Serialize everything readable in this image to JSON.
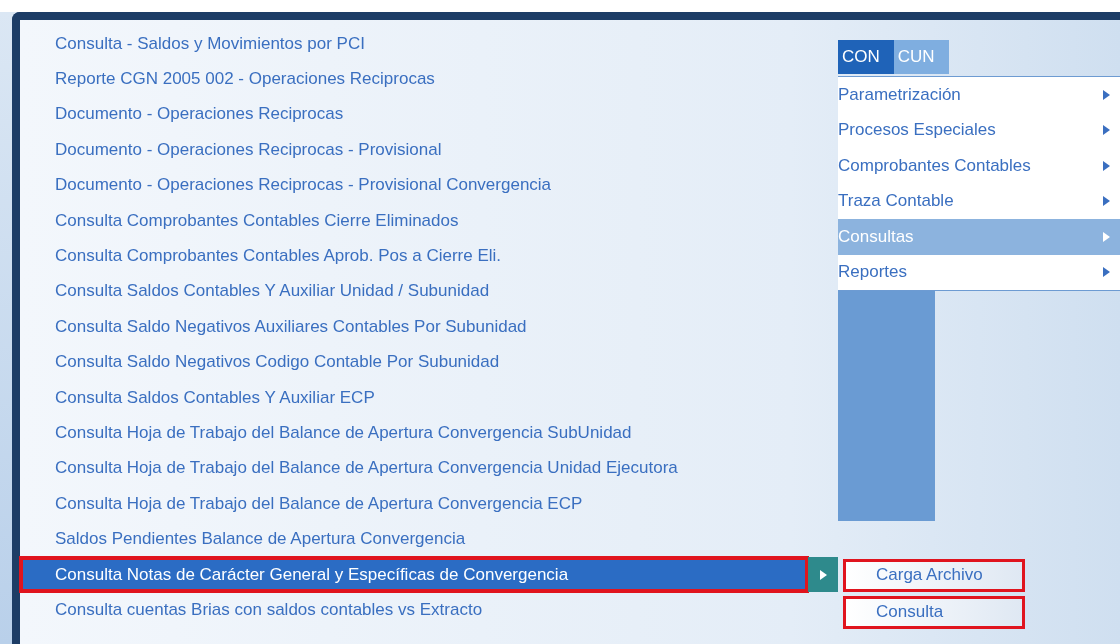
{
  "top_tabs": [
    {
      "label": "CON",
      "selected": true
    },
    {
      "label": "CUN",
      "selected": false
    }
  ],
  "module_menu": [
    {
      "label": "Parametrización",
      "selected": false
    },
    {
      "label": "Procesos Especiales",
      "selected": false
    },
    {
      "label": "Comprobantes Contables",
      "selected": false
    },
    {
      "label": "Traza Contable",
      "selected": false
    },
    {
      "label": "Consultas",
      "selected": true
    },
    {
      "label": "Reportes",
      "selected": false
    }
  ],
  "consultas_menu": [
    {
      "label": "Consulta - Saldos y Movimientos por PCI",
      "selected": false,
      "highlighted": false
    },
    {
      "label": "Reporte CGN 2005 002 - Operaciones Reciprocas",
      "selected": false,
      "highlighted": false
    },
    {
      "label": "Documento - Operaciones Reciprocas",
      "selected": false,
      "highlighted": false
    },
    {
      "label": "Documento - Operaciones Reciprocas - Provisional",
      "selected": false,
      "highlighted": false
    },
    {
      "label": "Documento - Operaciones Reciprocas - Provisional Convergencia",
      "selected": false,
      "highlighted": false
    },
    {
      "label": "Consulta Comprobantes Contables Cierre Eliminados",
      "selected": false,
      "highlighted": false
    },
    {
      "label": "Consulta Comprobantes Contables Aprob. Pos a Cierre Eli.",
      "selected": false,
      "highlighted": false
    },
    {
      "label": "Consulta Saldos Contables Y Auxiliar Unidad / Subunidad",
      "selected": false,
      "highlighted": false
    },
    {
      "label": "Consulta Saldo Negativos Auxiliares Contables Por Subunidad",
      "selected": false,
      "highlighted": false
    },
    {
      "label": "Consulta Saldo Negativos Codigo Contable Por Subunidad",
      "selected": false,
      "highlighted": false
    },
    {
      "label": "Consulta Saldos Contables Y Auxiliar ECP",
      "selected": false,
      "highlighted": false
    },
    {
      "label": "Consulta Hoja de Trabajo del Balance de Apertura Convergencia SubUnidad",
      "selected": false,
      "highlighted": false
    },
    {
      "label": "Consulta Hoja de Trabajo del Balance de Apertura Convergencia Unidad Ejecutora",
      "selected": false,
      "highlighted": false
    },
    {
      "label": "Consulta Hoja de Trabajo del Balance de Apertura Convergencia ECP",
      "selected": false,
      "highlighted": false
    },
    {
      "label": "Saldos Pendientes Balance de Apertura Convergencia",
      "selected": false,
      "highlighted": false
    },
    {
      "label": "Consulta Notas de Carácter General y Específicas de Convergencia",
      "selected": true,
      "highlighted": true
    },
    {
      "label": "Consulta cuentas Brias con saldos contables vs Extracto",
      "selected": false,
      "highlighted": false
    }
  ],
  "submenu": [
    {
      "label": "Carga Archivo",
      "highlighted": true
    },
    {
      "label": "Consulta",
      "highlighted": true
    }
  ]
}
